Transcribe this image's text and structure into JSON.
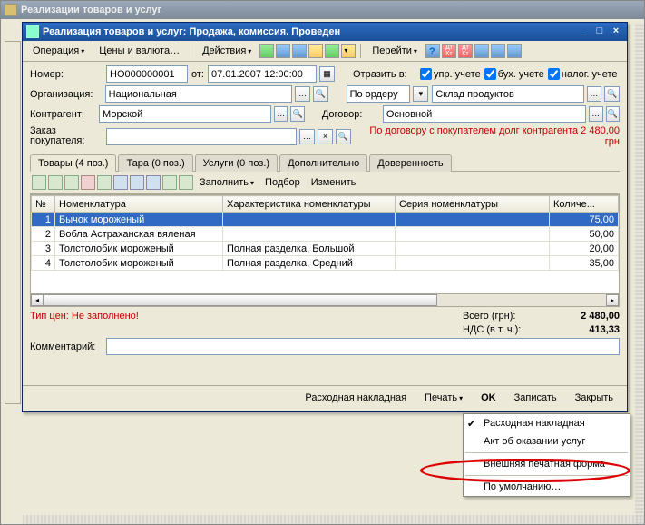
{
  "outer_title": "Реализации товаров и услуг",
  "window_title": "Реализация товаров и услуг: Продажа, комиссия. Проведен",
  "menubar": {
    "operation": "Операция",
    "prices": "Цены и валюта…",
    "actions": "Действия",
    "goto": "Перейти"
  },
  "form": {
    "number_label": "Номер:",
    "number_value": "НО000000001",
    "date_label": "от:",
    "date_value": "07.01.2007 12:00:00",
    "reflect_label": "Отразить в:",
    "upr": "упр. учете",
    "bukh": "бух. учете",
    "nalog": "налог. учете",
    "org_label": "Организация:",
    "org_value": "Национальная",
    "order_label": "По ордеру",
    "warehouse_value": "Склад продуктов",
    "contr_label": "Контрагент:",
    "contr_value": "Морской",
    "contract_label": "Договор:",
    "contract_value": "Основной",
    "buyer_order_label": "Заказ покупателя:",
    "buyer_order_value": "",
    "contract_note": "По договору с покупателем долг контрагента 2 480,00 грн"
  },
  "tabs": {
    "goods": "Товары (4 поз.)",
    "tare": "Тара (0 поз.)",
    "services": "Услуги (0 поз.)",
    "extra": "Дополнительно",
    "proxy": "Доверенность"
  },
  "grid_toolbar": {
    "fill": "Заполнить",
    "select": "Подбор",
    "change": "Изменить"
  },
  "grid": {
    "cols": {
      "n": "№",
      "nom": "Номенклатура",
      "char": "Характеристика номенклатуры",
      "series": "Серия номенклатуры",
      "qty": "Количе..."
    },
    "rows": [
      {
        "n": "1",
        "nom": "Бычок мороженый",
        "char": "",
        "series": "",
        "qty": "75,00"
      },
      {
        "n": "2",
        "nom": "Вобла Астраханская вяленая",
        "char": "",
        "series": "",
        "qty": "50,00"
      },
      {
        "n": "3",
        "nom": "Толстолобик мороженый",
        "char": "Полная разделка, Большой",
        "series": "",
        "qty": "20,00"
      },
      {
        "n": "4",
        "nom": "Толстолобик мороженый",
        "char": "Полная разделка, Средний",
        "series": "",
        "qty": "35,00"
      }
    ]
  },
  "footer": {
    "price_type": "Тип цен: Не заполнено!",
    "total_label": "Всего (грн):",
    "total_value": "2 480,00",
    "nds_label": "НДС (в т. ч.):",
    "nds_value": "413,33",
    "comment_label": "Комментарий:",
    "comment_value": ""
  },
  "buttons": {
    "invoice": "Расходная накладная",
    "print": "Печать",
    "ok": "OK",
    "save": "Записать",
    "close": "Закрыть"
  },
  "print_menu": {
    "invoice": "Расходная накладная",
    "act": "Акт об оказании услуг",
    "external": "Внешняя печатная форма",
    "default": "По умолчанию…"
  }
}
